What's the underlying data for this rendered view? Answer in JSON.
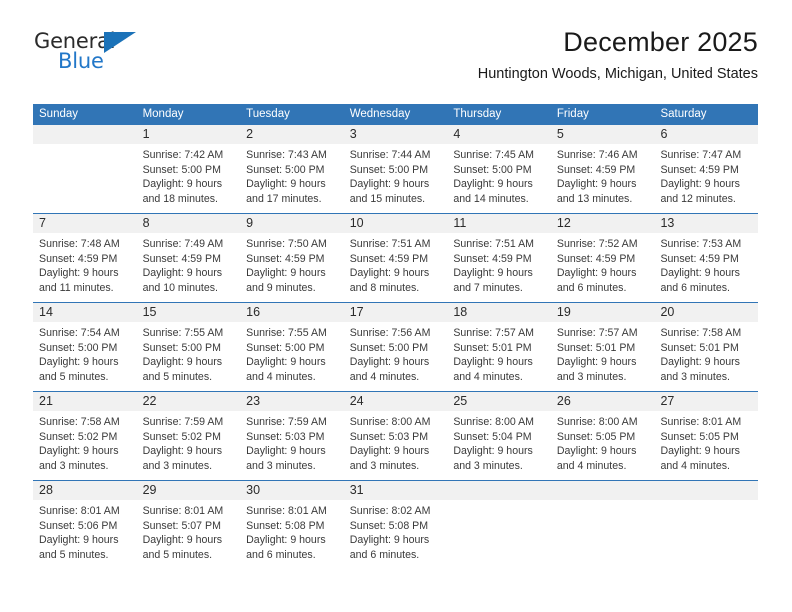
{
  "logo": {
    "word_top": "General",
    "word_bottom": "Blue",
    "flag_icon": "blue-triangle-flag-icon",
    "accent_color": "#1b72b8"
  },
  "header": {
    "title": "December 2025",
    "subtitle": "Huntington Woods, Michigan, United States"
  },
  "theme": {
    "header_blue": "#3175b6",
    "daynum_band": "#f1f1f1",
    "text": "#3a3a3a"
  },
  "calendar": {
    "weekday_headers": [
      "Sunday",
      "Monday",
      "Tuesday",
      "Wednesday",
      "Thursday",
      "Friday",
      "Saturday"
    ],
    "weeks": [
      [
        {
          "day": "",
          "sunrise": "",
          "sunset": "",
          "daylight": ""
        },
        {
          "day": "1",
          "sunrise": "Sunrise: 7:42 AM",
          "sunset": "Sunset: 5:00 PM",
          "daylight": "Daylight: 9 hours and 18 minutes."
        },
        {
          "day": "2",
          "sunrise": "Sunrise: 7:43 AM",
          "sunset": "Sunset: 5:00 PM",
          "daylight": "Daylight: 9 hours and 17 minutes."
        },
        {
          "day": "3",
          "sunrise": "Sunrise: 7:44 AM",
          "sunset": "Sunset: 5:00 PM",
          "daylight": "Daylight: 9 hours and 15 minutes."
        },
        {
          "day": "4",
          "sunrise": "Sunrise: 7:45 AM",
          "sunset": "Sunset: 5:00 PM",
          "daylight": "Daylight: 9 hours and 14 minutes."
        },
        {
          "day": "5",
          "sunrise": "Sunrise: 7:46 AM",
          "sunset": "Sunset: 4:59 PM",
          "daylight": "Daylight: 9 hours and 13 minutes."
        },
        {
          "day": "6",
          "sunrise": "Sunrise: 7:47 AM",
          "sunset": "Sunset: 4:59 PM",
          "daylight": "Daylight: 9 hours and 12 minutes."
        }
      ],
      [
        {
          "day": "7",
          "sunrise": "Sunrise: 7:48 AM",
          "sunset": "Sunset: 4:59 PM",
          "daylight": "Daylight: 9 hours and 11 minutes."
        },
        {
          "day": "8",
          "sunrise": "Sunrise: 7:49 AM",
          "sunset": "Sunset: 4:59 PM",
          "daylight": "Daylight: 9 hours and 10 minutes."
        },
        {
          "day": "9",
          "sunrise": "Sunrise: 7:50 AM",
          "sunset": "Sunset: 4:59 PM",
          "daylight": "Daylight: 9 hours and 9 minutes."
        },
        {
          "day": "10",
          "sunrise": "Sunrise: 7:51 AM",
          "sunset": "Sunset: 4:59 PM",
          "daylight": "Daylight: 9 hours and 8 minutes."
        },
        {
          "day": "11",
          "sunrise": "Sunrise: 7:51 AM",
          "sunset": "Sunset: 4:59 PM",
          "daylight": "Daylight: 9 hours and 7 minutes."
        },
        {
          "day": "12",
          "sunrise": "Sunrise: 7:52 AM",
          "sunset": "Sunset: 4:59 PM",
          "daylight": "Daylight: 9 hours and 6 minutes."
        },
        {
          "day": "13",
          "sunrise": "Sunrise: 7:53 AM",
          "sunset": "Sunset: 4:59 PM",
          "daylight": "Daylight: 9 hours and 6 minutes."
        }
      ],
      [
        {
          "day": "14",
          "sunrise": "Sunrise: 7:54 AM",
          "sunset": "Sunset: 5:00 PM",
          "daylight": "Daylight: 9 hours and 5 minutes."
        },
        {
          "day": "15",
          "sunrise": "Sunrise: 7:55 AM",
          "sunset": "Sunset: 5:00 PM",
          "daylight": "Daylight: 9 hours and 5 minutes."
        },
        {
          "day": "16",
          "sunrise": "Sunrise: 7:55 AM",
          "sunset": "Sunset: 5:00 PM",
          "daylight": "Daylight: 9 hours and 4 minutes."
        },
        {
          "day": "17",
          "sunrise": "Sunrise: 7:56 AM",
          "sunset": "Sunset: 5:00 PM",
          "daylight": "Daylight: 9 hours and 4 minutes."
        },
        {
          "day": "18",
          "sunrise": "Sunrise: 7:57 AM",
          "sunset": "Sunset: 5:01 PM",
          "daylight": "Daylight: 9 hours and 4 minutes."
        },
        {
          "day": "19",
          "sunrise": "Sunrise: 7:57 AM",
          "sunset": "Sunset: 5:01 PM",
          "daylight": "Daylight: 9 hours and 3 minutes."
        },
        {
          "day": "20",
          "sunrise": "Sunrise: 7:58 AM",
          "sunset": "Sunset: 5:01 PM",
          "daylight": "Daylight: 9 hours and 3 minutes."
        }
      ],
      [
        {
          "day": "21",
          "sunrise": "Sunrise: 7:58 AM",
          "sunset": "Sunset: 5:02 PM",
          "daylight": "Daylight: 9 hours and 3 minutes."
        },
        {
          "day": "22",
          "sunrise": "Sunrise: 7:59 AM",
          "sunset": "Sunset: 5:02 PM",
          "daylight": "Daylight: 9 hours and 3 minutes."
        },
        {
          "day": "23",
          "sunrise": "Sunrise: 7:59 AM",
          "sunset": "Sunset: 5:03 PM",
          "daylight": "Daylight: 9 hours and 3 minutes."
        },
        {
          "day": "24",
          "sunrise": "Sunrise: 8:00 AM",
          "sunset": "Sunset: 5:03 PM",
          "daylight": "Daylight: 9 hours and 3 minutes."
        },
        {
          "day": "25",
          "sunrise": "Sunrise: 8:00 AM",
          "sunset": "Sunset: 5:04 PM",
          "daylight": "Daylight: 9 hours and 3 minutes."
        },
        {
          "day": "26",
          "sunrise": "Sunrise: 8:00 AM",
          "sunset": "Sunset: 5:05 PM",
          "daylight": "Daylight: 9 hours and 4 minutes."
        },
        {
          "day": "27",
          "sunrise": "Sunrise: 8:01 AM",
          "sunset": "Sunset: 5:05 PM",
          "daylight": "Daylight: 9 hours and 4 minutes."
        }
      ],
      [
        {
          "day": "28",
          "sunrise": "Sunrise: 8:01 AM",
          "sunset": "Sunset: 5:06 PM",
          "daylight": "Daylight: 9 hours and 5 minutes."
        },
        {
          "day": "29",
          "sunrise": "Sunrise: 8:01 AM",
          "sunset": "Sunset: 5:07 PM",
          "daylight": "Daylight: 9 hours and 5 minutes."
        },
        {
          "day": "30",
          "sunrise": "Sunrise: 8:01 AM",
          "sunset": "Sunset: 5:08 PM",
          "daylight": "Daylight: 9 hours and 6 minutes."
        },
        {
          "day": "31",
          "sunrise": "Sunrise: 8:02 AM",
          "sunset": "Sunset: 5:08 PM",
          "daylight": "Daylight: 9 hours and 6 minutes."
        },
        {
          "day": "",
          "sunrise": "",
          "sunset": "",
          "daylight": ""
        },
        {
          "day": "",
          "sunrise": "",
          "sunset": "",
          "daylight": ""
        },
        {
          "day": "",
          "sunrise": "",
          "sunset": "",
          "daylight": ""
        }
      ]
    ]
  }
}
